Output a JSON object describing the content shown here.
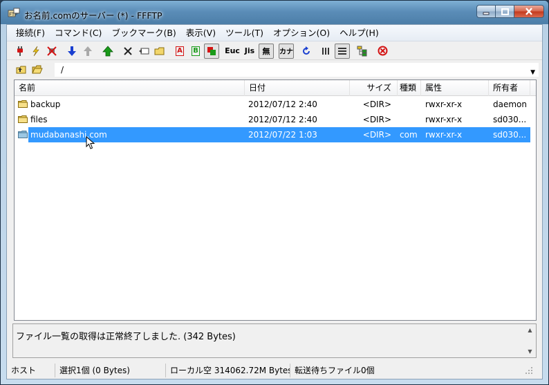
{
  "window": {
    "title": "お名前.comのサーバー (*) - FFFTP"
  },
  "menu": [
    "接続(F)",
    "コマンド(C)",
    "ブックマーク(B)",
    "表示(V)",
    "ツール(T)",
    "オプション(O)",
    "ヘルプ(H)"
  ],
  "toolbar": {
    "ascii_label": "A",
    "binary_label": "B",
    "euc_label": "Euc",
    "jis_label": "Jis",
    "nocode_label": "無",
    "kana_label": "カナ",
    "colors": {
      "green": "#1a9b1a",
      "red": "#d41414",
      "blue": "#1a3fd0"
    }
  },
  "path": {
    "value": "/"
  },
  "columns": {
    "name": "名前",
    "date": "日付",
    "size": "サイズ",
    "type": "種類",
    "attr": "属性",
    "owner": "所有者"
  },
  "files": [
    {
      "name": "backup",
      "date": "2012/07/12  2:40",
      "size": "<DIR>",
      "type": "",
      "attr": "rwxr-xr-x",
      "owner": "daemon",
      "selected": false
    },
    {
      "name": "files",
      "date": "2012/07/12  2:40",
      "size": "<DIR>",
      "type": "",
      "attr": "rwxr-xr-x",
      "owner": "sd030...",
      "selected": false
    },
    {
      "name": "mudabanashi.com",
      "date": "2012/07/22  1:03",
      "size": "<DIR>",
      "type": "com",
      "attr": "rwxr-xr-x",
      "owner": "sd030...",
      "selected": true
    }
  ],
  "log": {
    "text": "ファイル一覧の取得は正常終了しました. (342 Bytes)"
  },
  "status": {
    "host": "ホスト",
    "selection": "選択1個 (0 Bytes)",
    "local": "ローカル空 314062.72M Bytes",
    "queue": "転送待ちファイル0個"
  }
}
